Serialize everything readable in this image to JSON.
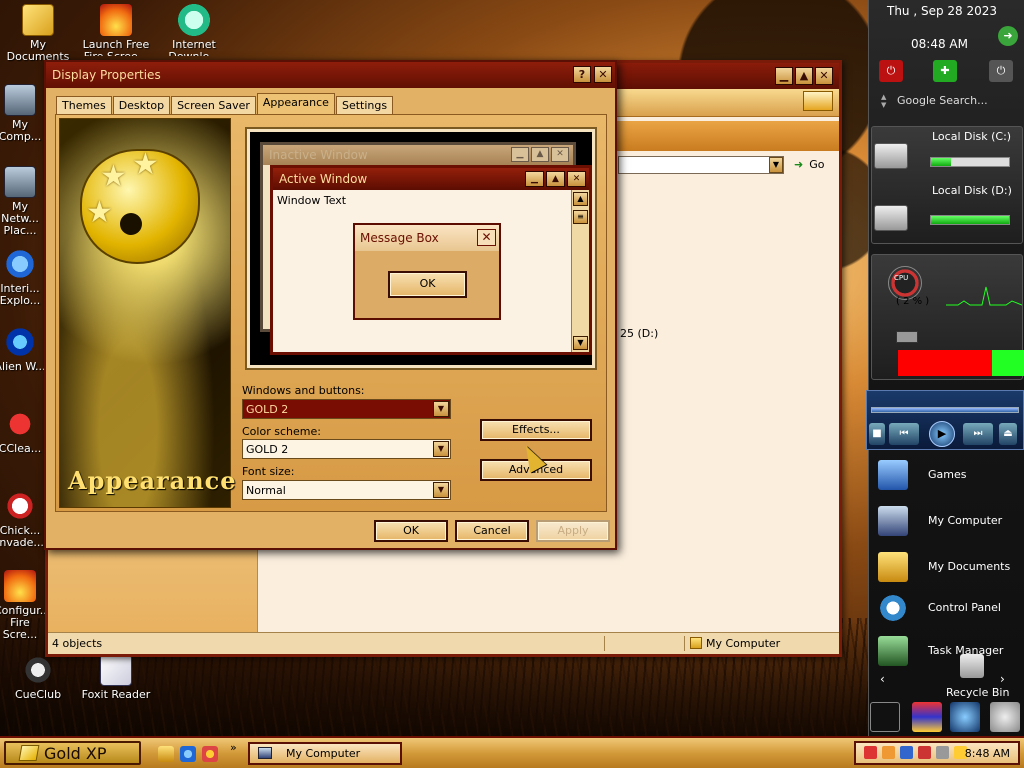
{
  "desktop": {
    "icons": [
      {
        "label": "My Documents"
      },
      {
        "label": "Launch Free Fire Scree..."
      },
      {
        "label": "Internet Downlo..."
      },
      {
        "label": "My Comp..."
      },
      {
        "label": "My Netw... Plac..."
      },
      {
        "label": "Interi... Explo..."
      },
      {
        "label": "Alien W..."
      },
      {
        "label": "CClea..."
      },
      {
        "label": "Chick... Invade..."
      },
      {
        "label": "Configur... Fire Scre..."
      },
      {
        "label": "CueClub"
      },
      {
        "label": "Foxit Reader"
      }
    ]
  },
  "explorer": {
    "go_label": "Go",
    "drive_text": "25 (D:)",
    "status_objects": "4 objects",
    "status_location": "My Computer"
  },
  "dialog": {
    "title": "Display Properties",
    "help_label": "?",
    "close_label": "✕",
    "tabs": [
      {
        "label": "Themes"
      },
      {
        "label": "Desktop"
      },
      {
        "label": "Screen Saver"
      },
      {
        "label": "Appearance",
        "active": true
      },
      {
        "label": "Settings"
      }
    ],
    "art_label": "Appearance",
    "preview": {
      "inactive_title": "Inactive Window",
      "active_title": "Active Window",
      "window_text": "Window Text",
      "message_title": "Message Box",
      "message_ok": "OK"
    },
    "windows_buttons_label": "Windows and buttons:",
    "windows_buttons_value": "GOLD 2",
    "color_scheme_label": "Color scheme:",
    "color_scheme_value": "GOLD 2",
    "font_size_label": "Font size:",
    "font_size_value": "Normal",
    "effects_label": "Effects...",
    "advanced_label": "Advanced",
    "ok_label": "OK",
    "cancel_label": "Cancel",
    "apply_label": "Apply"
  },
  "sidebar": {
    "date": "Thu , Sep 28 2023",
    "time": "08:48 AM",
    "search_placeholder": "Google Search...",
    "disk_c_label": "Local Disk (C:)",
    "disk_c_used": 0.25,
    "disk_d_label": "Local Disk (D:)",
    "disk_d_used": 1.0,
    "cpu_label": "CPU",
    "cpu_pct": "( 2 % )",
    "items": [
      {
        "label": "Games"
      },
      {
        "label": "My Computer"
      },
      {
        "label": "My Documents"
      },
      {
        "label": "Control Panel"
      },
      {
        "label": "Task Manager"
      },
      {
        "label": "Recycle Bin"
      }
    ]
  },
  "taskbar": {
    "start_label": "Gold XP",
    "task_label": "My Computer",
    "clock": "8:48 AM",
    "overflow": "»"
  },
  "colors": {
    "title_red": "#7a1a08",
    "gold": "#e3b165",
    "selected_red": "#7a0d03"
  }
}
